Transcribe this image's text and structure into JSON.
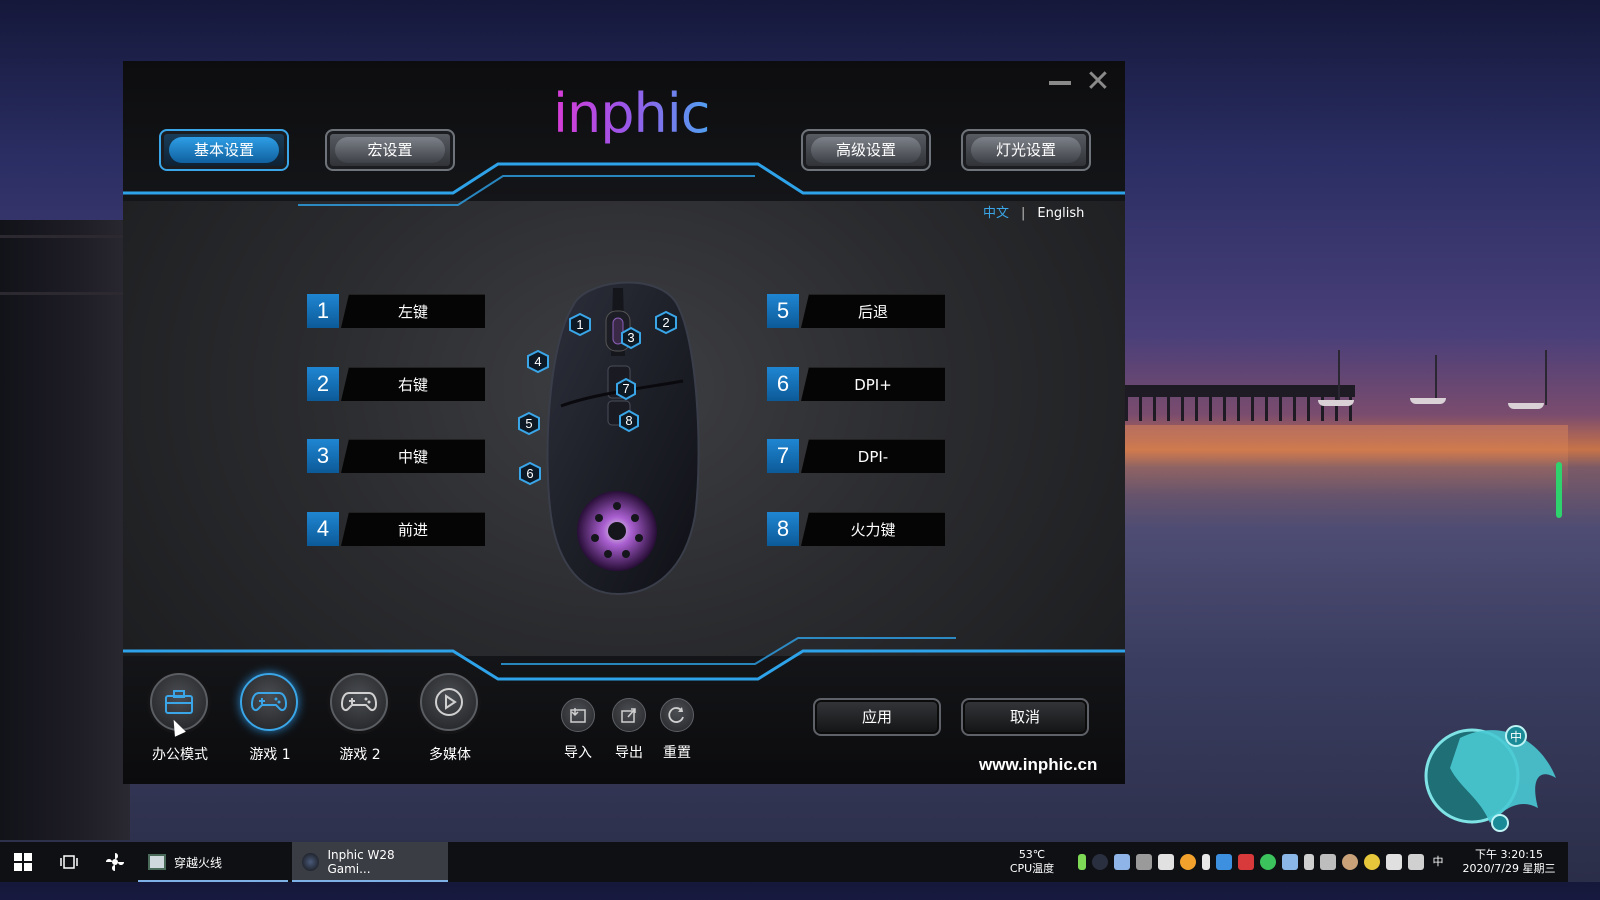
{
  "app": {
    "logo_text": "inphic",
    "nav": {
      "basic": "基本设置",
      "macro": "宏设置",
      "advanced": "高级设置",
      "lighting": "灯光设置",
      "active": "basic"
    },
    "language": {
      "zh": "中文",
      "separator": "|",
      "en": "English",
      "selected": "zh"
    },
    "buttons_left": [
      {
        "num": "1",
        "label": "左键"
      },
      {
        "num": "2",
        "label": "右键"
      },
      {
        "num": "3",
        "label": "中键"
      },
      {
        "num": "4",
        "label": "前进"
      }
    ],
    "buttons_right": [
      {
        "num": "5",
        "label": "后退"
      },
      {
        "num": "6",
        "label": "DPI+"
      },
      {
        "num": "7",
        "label": "DPI-"
      },
      {
        "num": "8",
        "label": "火力键"
      }
    ],
    "mouse_markers": [
      "1",
      "2",
      "3",
      "4",
      "5",
      "6",
      "7",
      "8"
    ],
    "modes": [
      {
        "label": "办公模式",
        "icon": "briefcase-icon"
      },
      {
        "label": "游戏 1",
        "icon": "gamepad-icon",
        "active": true
      },
      {
        "label": "游戏 2",
        "icon": "gamepad-icon"
      },
      {
        "label": "多媒体",
        "icon": "play-icon"
      }
    ],
    "tools": [
      {
        "label": "导入",
        "icon": "import-icon"
      },
      {
        "label": "导出",
        "icon": "export-icon"
      },
      {
        "label": "重置",
        "icon": "reset-icon"
      }
    ],
    "apply": "应用",
    "cancel": "取消",
    "website": "www.inphic.cn",
    "colors": {
      "accent": "#3aa6e8",
      "key_number_bg": "#1f86d2",
      "logo_pink": "#d93bd6",
      "logo_blue": "#4da3f1"
    }
  },
  "taskbar": {
    "apps": [
      {
        "label": "穿越火线"
      },
      {
        "label": "Inphic W28 Gami...",
        "active": true
      }
    ],
    "cpu_temp": "53℃",
    "cpu_label": "CPU温度",
    "ime": "中",
    "time": "下午 3:20:15",
    "date": "2020/7/29 星期三"
  }
}
